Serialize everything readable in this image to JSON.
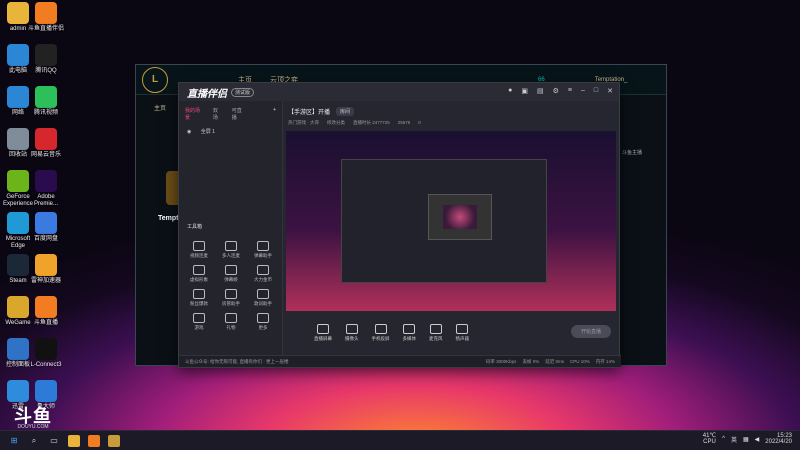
{
  "desktop": {
    "icons_left": [
      {
        "label": "admin",
        "icon": "folder-icon",
        "color": "#e8b53a"
      },
      {
        "label": "此电脑",
        "icon": "computer-icon",
        "color": "#2b86d6"
      },
      {
        "label": "网络",
        "icon": "network-icon",
        "color": "#2b86d6"
      },
      {
        "label": "回收站",
        "icon": "recycle-bin-icon",
        "color": "#7f8c99"
      },
      {
        "label": "GeForce Experience",
        "icon": "geforce-icon",
        "color": "#6bb51a"
      },
      {
        "label": "Microsoft Edge",
        "icon": "edge-icon",
        "color": "#1f9ad6"
      },
      {
        "label": "Steam",
        "icon": "steam-icon",
        "color": "#1b2838"
      },
      {
        "label": "WeGame",
        "icon": "wegame-icon",
        "color": "#d8a72b"
      },
      {
        "label": "控制面板",
        "icon": "control-panel-icon",
        "color": "#2f72c6"
      },
      {
        "label": "迅雷",
        "icon": "xunlei-icon",
        "color": "#2f8bdc"
      }
    ],
    "icons_right": [
      {
        "label": "斗鱼直播伴侣",
        "icon": "douyu-icon",
        "color": "#f17c21"
      },
      {
        "label": "腾讯QQ",
        "icon": "qq-icon",
        "color": "#222222"
      },
      {
        "label": "腾讯视频",
        "icon": "tencent-video-icon",
        "color": "#2dbf5a"
      },
      {
        "label": "网易云音乐",
        "icon": "netease-music-icon",
        "color": "#d6262e"
      },
      {
        "label": "Adobe Premie...",
        "icon": "premiere-icon",
        "color": "#2a0c4e"
      },
      {
        "label": "百度网盘",
        "icon": "baidu-netdisk-icon",
        "color": "#3b7ae0"
      },
      {
        "label": "雷神加速器",
        "icon": "leishen-icon",
        "color": "#f0a32a"
      },
      {
        "label": "斗鱼直播",
        "icon": "douyu-live-icon",
        "color": "#f17c21"
      },
      {
        "label": "L-Connect3",
        "icon": "lconnect-icon",
        "color": "#111111"
      },
      {
        "label": "鲁大师",
        "icon": "ludashi-icon",
        "color": "#2d7bd8"
      }
    ]
  },
  "lol_client": {
    "title": "Temptation_",
    "title_trunc": "Tempt",
    "nav": [
      "主页",
      "云顶之弈",
      "TFT"
    ],
    "coins": "66",
    "sub": "主页",
    "side_text": "斗鱼主播"
  },
  "app": {
    "logo": "直播伴侣",
    "beta": "测试版",
    "tabs": [
      "我的场景",
      "双场",
      "可直播"
    ],
    "scene": "全屏 1",
    "tool_title": "工具箱",
    "tools": [
      "视频连麦",
      "多人连麦",
      "弹幕助手",
      "虚拟形象",
      "弹幕姬",
      "大力金币",
      "粉丝爆款",
      "房管助手",
      "歌词助手",
      "游戏",
      "礼物",
      "更多"
    ],
    "room_title": "【手游区】开播",
    "room_tag": "房间",
    "room_info": [
      "热门游戏 · 大哥",
      "修改分类",
      "直播时长 2477725",
      "25575",
      "0"
    ],
    "controls": [
      "直播屏幕",
      "摄像头",
      "手机投屏",
      "多媒体",
      "麦克风",
      "扬声器"
    ],
    "start_btn": "开始直播",
    "status": "斗鱼公众号: 给你无限可能, 直播有你们 · 更上一层楼",
    "status_right": [
      "码率 3000Kbps",
      "丢帧 0%",
      "延迟 0ms",
      "CPU 10%",
      "内存 14%"
    ]
  },
  "taskbar": {
    "temp": "41℃",
    "temp_label": "CPU",
    "lang": "英",
    "time": "15:23",
    "date": "2022/4/20"
  },
  "watermark": {
    "big": "斗鱼",
    "small": "DOUYU.COM"
  }
}
